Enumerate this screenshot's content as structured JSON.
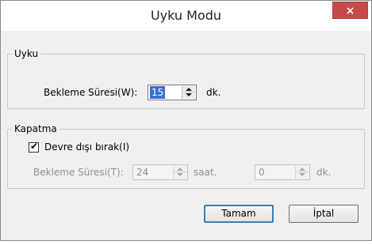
{
  "window": {
    "title": "Uyku Modu",
    "close_glyph": "×"
  },
  "sleep_group": {
    "legend": "Uyku",
    "wait_label": "Bekleme Süresi(W):",
    "wait_value": "15",
    "wait_unit": "dk."
  },
  "shutdown_group": {
    "legend": "Kapatma",
    "disable_label": "Devre dışı bırak(I)",
    "disable_checked": true,
    "check_glyph": "✔",
    "wait_label": "Bekleme Süresi(T):",
    "hours_value": "24",
    "hours_unit": "saat.",
    "minutes_value": "0",
    "minutes_unit": "dk."
  },
  "buttons": {
    "ok_label": "Tamam",
    "cancel_label": "İptal"
  },
  "colors": {
    "close_button": "#c74a4a",
    "selection": "#3a6fd0",
    "default_button_border": "#3c7fb1"
  }
}
